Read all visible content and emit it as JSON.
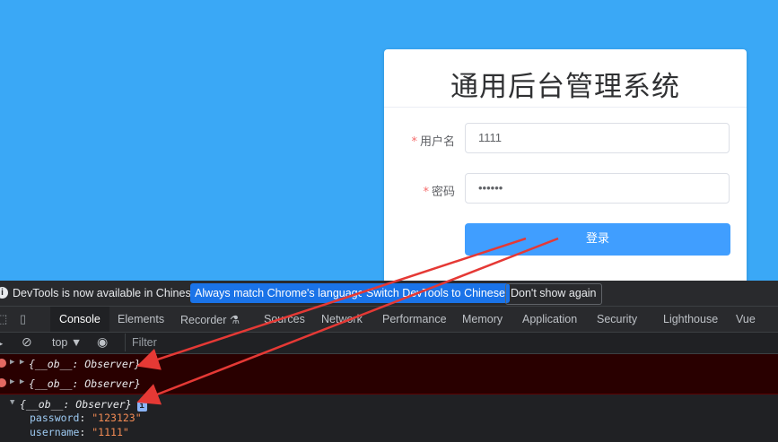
{
  "login": {
    "title": "通用后台管理系统",
    "username_label": "用户名",
    "username_value": "1111",
    "password_label": "密码",
    "password_value": "••••••",
    "submit_label": "登录"
  },
  "devtools": {
    "info_text": "DevTools is now available in Chinese!",
    "info_btn_match": "Always match Chrome's language",
    "info_btn_switch": "Switch DevTools to Chinese",
    "info_btn_dismiss": "Don't show again",
    "tabs": [
      "Console",
      "Elements",
      "Recorder ⚗",
      "Sources",
      "Network",
      "Performance",
      "Memory",
      "Application",
      "Security",
      "Lighthouse",
      "Vue"
    ],
    "context": "top ▼",
    "filter_placeholder": "Filter",
    "logs": [
      "{__ob__: Observer}",
      "{__ob__: Observer}",
      "{__ob__: Observer}"
    ],
    "props": [
      {
        "key": "password",
        "value": "\"123123\""
      },
      {
        "key": "username",
        "value": "\"1111\""
      }
    ]
  }
}
